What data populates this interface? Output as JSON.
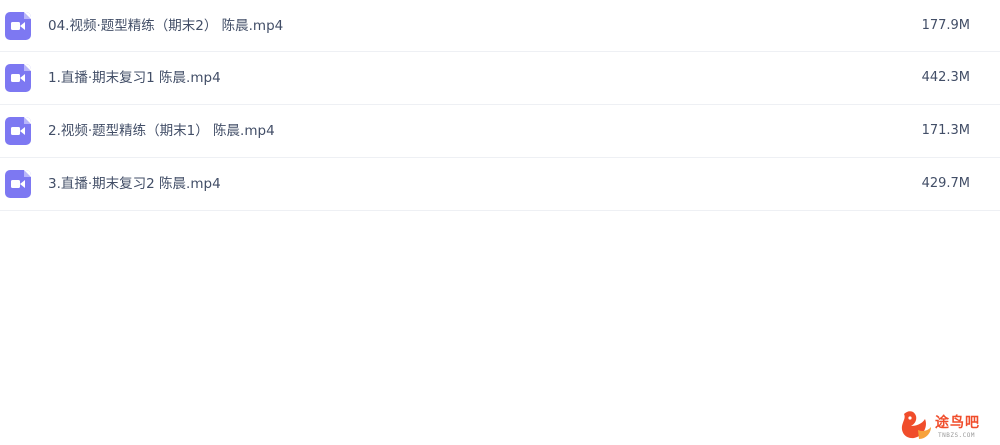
{
  "files": [
    {
      "name": "04.视频·题型精练（期末2） 陈晨.mp4",
      "size": "177.9M",
      "icon": "video-file-icon"
    },
    {
      "name": "1.直播·期末复习1 陈晨.mp4",
      "size": "442.3M",
      "icon": "video-file-icon"
    },
    {
      "name": "2.视频·题型精练（期末1） 陈晨.mp4",
      "size": "171.3M",
      "icon": "video-file-icon"
    },
    {
      "name": "3.直播·期末复习2 陈晨.mp4",
      "size": "429.7M",
      "icon": "video-file-icon"
    }
  ],
  "watermark": {
    "text": "途鸟吧",
    "sub": "TNBZS.COM",
    "color": "#f04d2b"
  },
  "colors": {
    "icon_bg": "#7d78f2",
    "text": "#424e67",
    "divider": "#eef0f4"
  }
}
